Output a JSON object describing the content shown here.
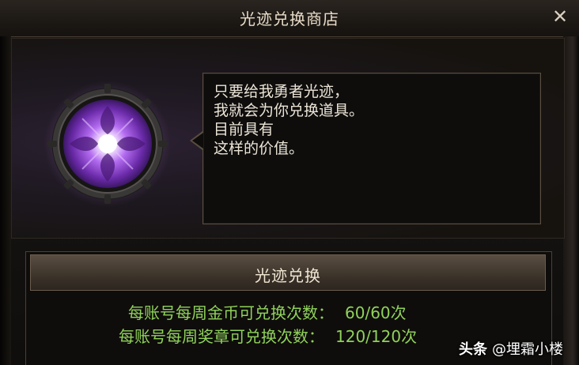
{
  "window": {
    "title": "光迹兑换商店",
    "close_glyph": "✕"
  },
  "npc": {
    "emblem_icon": "light-trace-emblem-icon",
    "dialog_lines": [
      "只要给我勇者光迹，",
      "我就会为你兑换道具。",
      "目前具有",
      "这样的价值。"
    ]
  },
  "exchange": {
    "header": "光迹兑换",
    "limits": [
      {
        "label": "每账号每周金币可兑换次数：",
        "value": "60/60次"
      },
      {
        "label": "每账号每周奖章可兑换次数：",
        "value": "120/120次"
      }
    ]
  },
  "watermark": {
    "brand": "头条",
    "author": "@埋霜小楼"
  },
  "colors": {
    "title_text": "#e8dcc8",
    "limit_text": "#8fd25b",
    "emblem_purple": "#9b4fd8"
  }
}
